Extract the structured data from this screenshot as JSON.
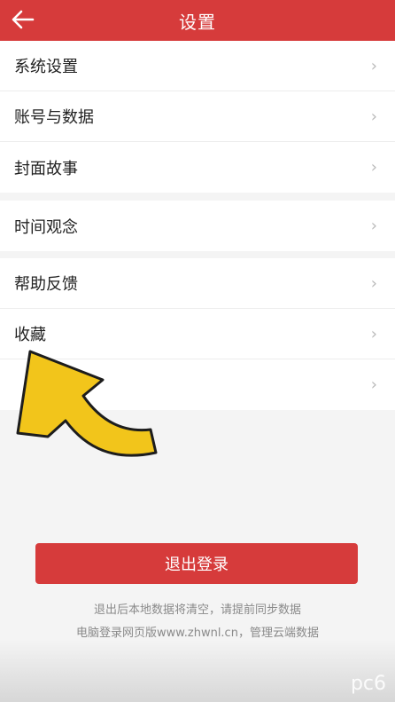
{
  "header": {
    "title": "设置"
  },
  "groups": [
    {
      "items": [
        {
          "label": "系统设置"
        },
        {
          "label": "账号与数据"
        },
        {
          "label": "封面故事"
        }
      ]
    },
    {
      "items": [
        {
          "label": "时间观念"
        }
      ]
    },
    {
      "items": [
        {
          "label": "帮助反馈"
        },
        {
          "label": "收藏"
        },
        {
          "label": ""
        }
      ]
    }
  ],
  "chevron": "›",
  "logout": {
    "label": "退出登录"
  },
  "notes": {
    "line1": "退出后本地数据将清空，请提前同步数据",
    "line2": "电脑登录网页版www.zhwnl.cn，管理云端数据"
  },
  "watermark": "pc6",
  "colors": {
    "accent": "#d63b3b",
    "arrow_fill": "#f2c51b"
  },
  "icons": {
    "back": "arrow-left-icon",
    "pointer": "curved-arrow-icon"
  }
}
